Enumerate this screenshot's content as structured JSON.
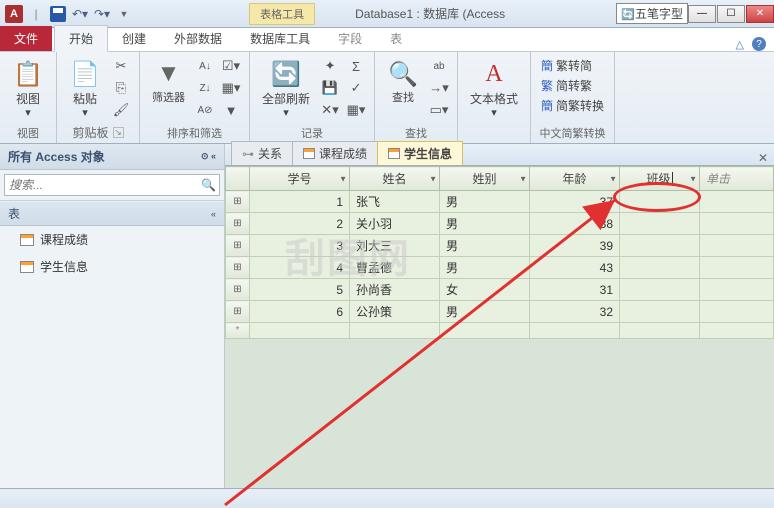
{
  "title": "Database1 : 数据库 (Access",
  "ime": "五笔字型",
  "contextual_tab_group": "表格工具",
  "ribbon_tabs": {
    "file": "文件",
    "home": "开始",
    "create": "创建",
    "external": "外部数据",
    "dbtools": "数据库工具",
    "fields": "字段",
    "table": "表"
  },
  "ribbon_groups": {
    "view": {
      "label": "视图",
      "btn": "视图"
    },
    "clipboard": {
      "label": "剪贴板",
      "btn": "粘贴"
    },
    "sortfilter": {
      "label": "排序和筛选",
      "btn": "筛选器"
    },
    "records": {
      "label": "记录",
      "btn": "全部刷新"
    },
    "find": {
      "label": "查找",
      "btn": "查找"
    },
    "textfmt": {
      "label": "",
      "btn": "文本格式"
    },
    "chinese": {
      "label": "中文简繁转换",
      "r1": "繁转简",
      "r2": "简转繁",
      "r3": "简繁转换"
    }
  },
  "nav": {
    "header": "所有 Access 对象",
    "search_placeholder": "搜索...",
    "group": "表",
    "items": [
      "课程成绩",
      "学生信息"
    ]
  },
  "doc_tabs": [
    {
      "label": "关系",
      "icon": "rel"
    },
    {
      "label": "课程成绩",
      "icon": "tbl"
    },
    {
      "label": "学生信息",
      "icon": "tbl",
      "active": true
    }
  ],
  "datasheet": {
    "columns": [
      "学号",
      "姓名",
      "姓别",
      "年龄",
      "班级"
    ],
    "add_col": "单击",
    "rows": [
      {
        "id": "1",
        "name": "张飞",
        "sex": "男",
        "age": "37",
        "cls": ""
      },
      {
        "id": "2",
        "name": "关小羽",
        "sex": "男",
        "age": "38",
        "cls": ""
      },
      {
        "id": "3",
        "name": "刘大三",
        "sex": "男",
        "age": "39",
        "cls": ""
      },
      {
        "id": "4",
        "name": "曹孟德",
        "sex": "男",
        "age": "43",
        "cls": ""
      },
      {
        "id": "5",
        "name": "孙尚香",
        "sex": "女",
        "age": "31",
        "cls": ""
      },
      {
        "id": "6",
        "name": "公孙策",
        "sex": "男",
        "age": "32",
        "cls": ""
      }
    ]
  },
  "watermark": "刮图网"
}
